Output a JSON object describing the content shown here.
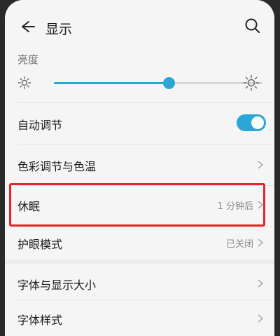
{
  "header": {
    "title": "显示"
  },
  "brightness": {
    "label": "亮度",
    "level": 0.55
  },
  "rows": [
    {
      "label": "自动调节",
      "value": "",
      "toggle_on": true
    },
    {
      "label": "色彩调节与色温",
      "value": ""
    },
    {
      "label": "休眠",
      "value": "1 分钟后"
    },
    {
      "label": "护眼模式",
      "value": "已关闭"
    },
    {
      "label": "字体与显示大小",
      "value": ""
    },
    {
      "label": "字体样式",
      "value": ""
    }
  ],
  "colors": {
    "accent": "#2aa7d6",
    "highlight": "#e8242a"
  }
}
